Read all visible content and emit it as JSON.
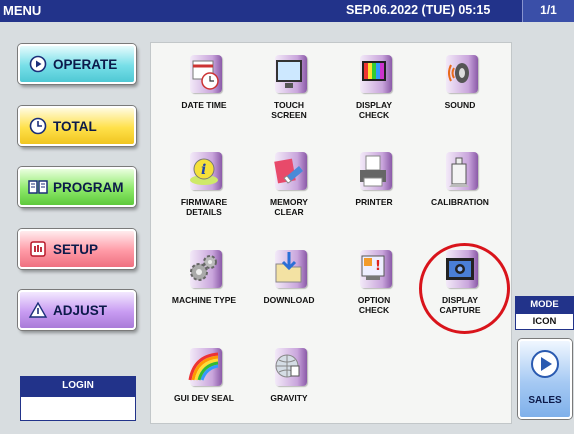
{
  "header": {
    "menu_title": "MENU",
    "datetime": "SEP.06.2022 (TUE) 05:15",
    "page": "1/1"
  },
  "sidebar": {
    "buttons": [
      {
        "label": "OPERATE",
        "icon": "play-circle-icon"
      },
      {
        "label": "TOTAL",
        "icon": "clock-icon"
      },
      {
        "label": "PROGRAM",
        "icon": "book-icon"
      },
      {
        "label": "SETUP",
        "icon": "setup-hand-icon"
      },
      {
        "label": "ADJUST",
        "icon": "adjust-triangle-icon"
      }
    ],
    "login_label": "LOGIN"
  },
  "grid": {
    "tiles": [
      {
        "line1": "DATE TIME",
        "line2": "",
        "icon": "calendar-clock-icon"
      },
      {
        "line1": "TOUCH",
        "line2": "SCREEN",
        "icon": "touch-screen-icon"
      },
      {
        "line1": "DISPLAY",
        "line2": "CHECK",
        "icon": "display-check-icon"
      },
      {
        "line1": "SOUND",
        "line2": "",
        "icon": "speaker-icon"
      },
      {
        "line1": "FIRMWARE",
        "line2": "DETAILS",
        "icon": "info-icon"
      },
      {
        "line1": "MEMORY",
        "line2": "CLEAR",
        "icon": "eraser-icon"
      },
      {
        "line1": "PRINTER",
        "line2": "",
        "icon": "printer-icon"
      },
      {
        "line1": "CALIBRATION",
        "line2": "",
        "icon": "calibration-weight-icon"
      },
      {
        "line1": "MACHINE TYPE",
        "line2": "",
        "icon": "gears-icon"
      },
      {
        "line1": "DOWNLOAD",
        "line2": "",
        "icon": "download-folder-icon"
      },
      {
        "line1": "OPTION",
        "line2": "CHECK",
        "icon": "option-check-icon"
      },
      {
        "line1": "DISPLAY",
        "line2": "CAPTURE",
        "icon": "camera-icon"
      },
      {
        "line1": "GUI DEV SEAL",
        "line2": "",
        "icon": "rainbow-icon"
      },
      {
        "line1": "GRAVITY",
        "line2": "",
        "icon": "globe-icon"
      }
    ]
  },
  "mode": {
    "label": "MODE",
    "value": "ICON"
  },
  "sales": {
    "label": "SALES",
    "icon": "play-arrow-icon"
  },
  "colors": {
    "header_bg": "#22338a",
    "highlight_ring": "#d9141b"
  }
}
